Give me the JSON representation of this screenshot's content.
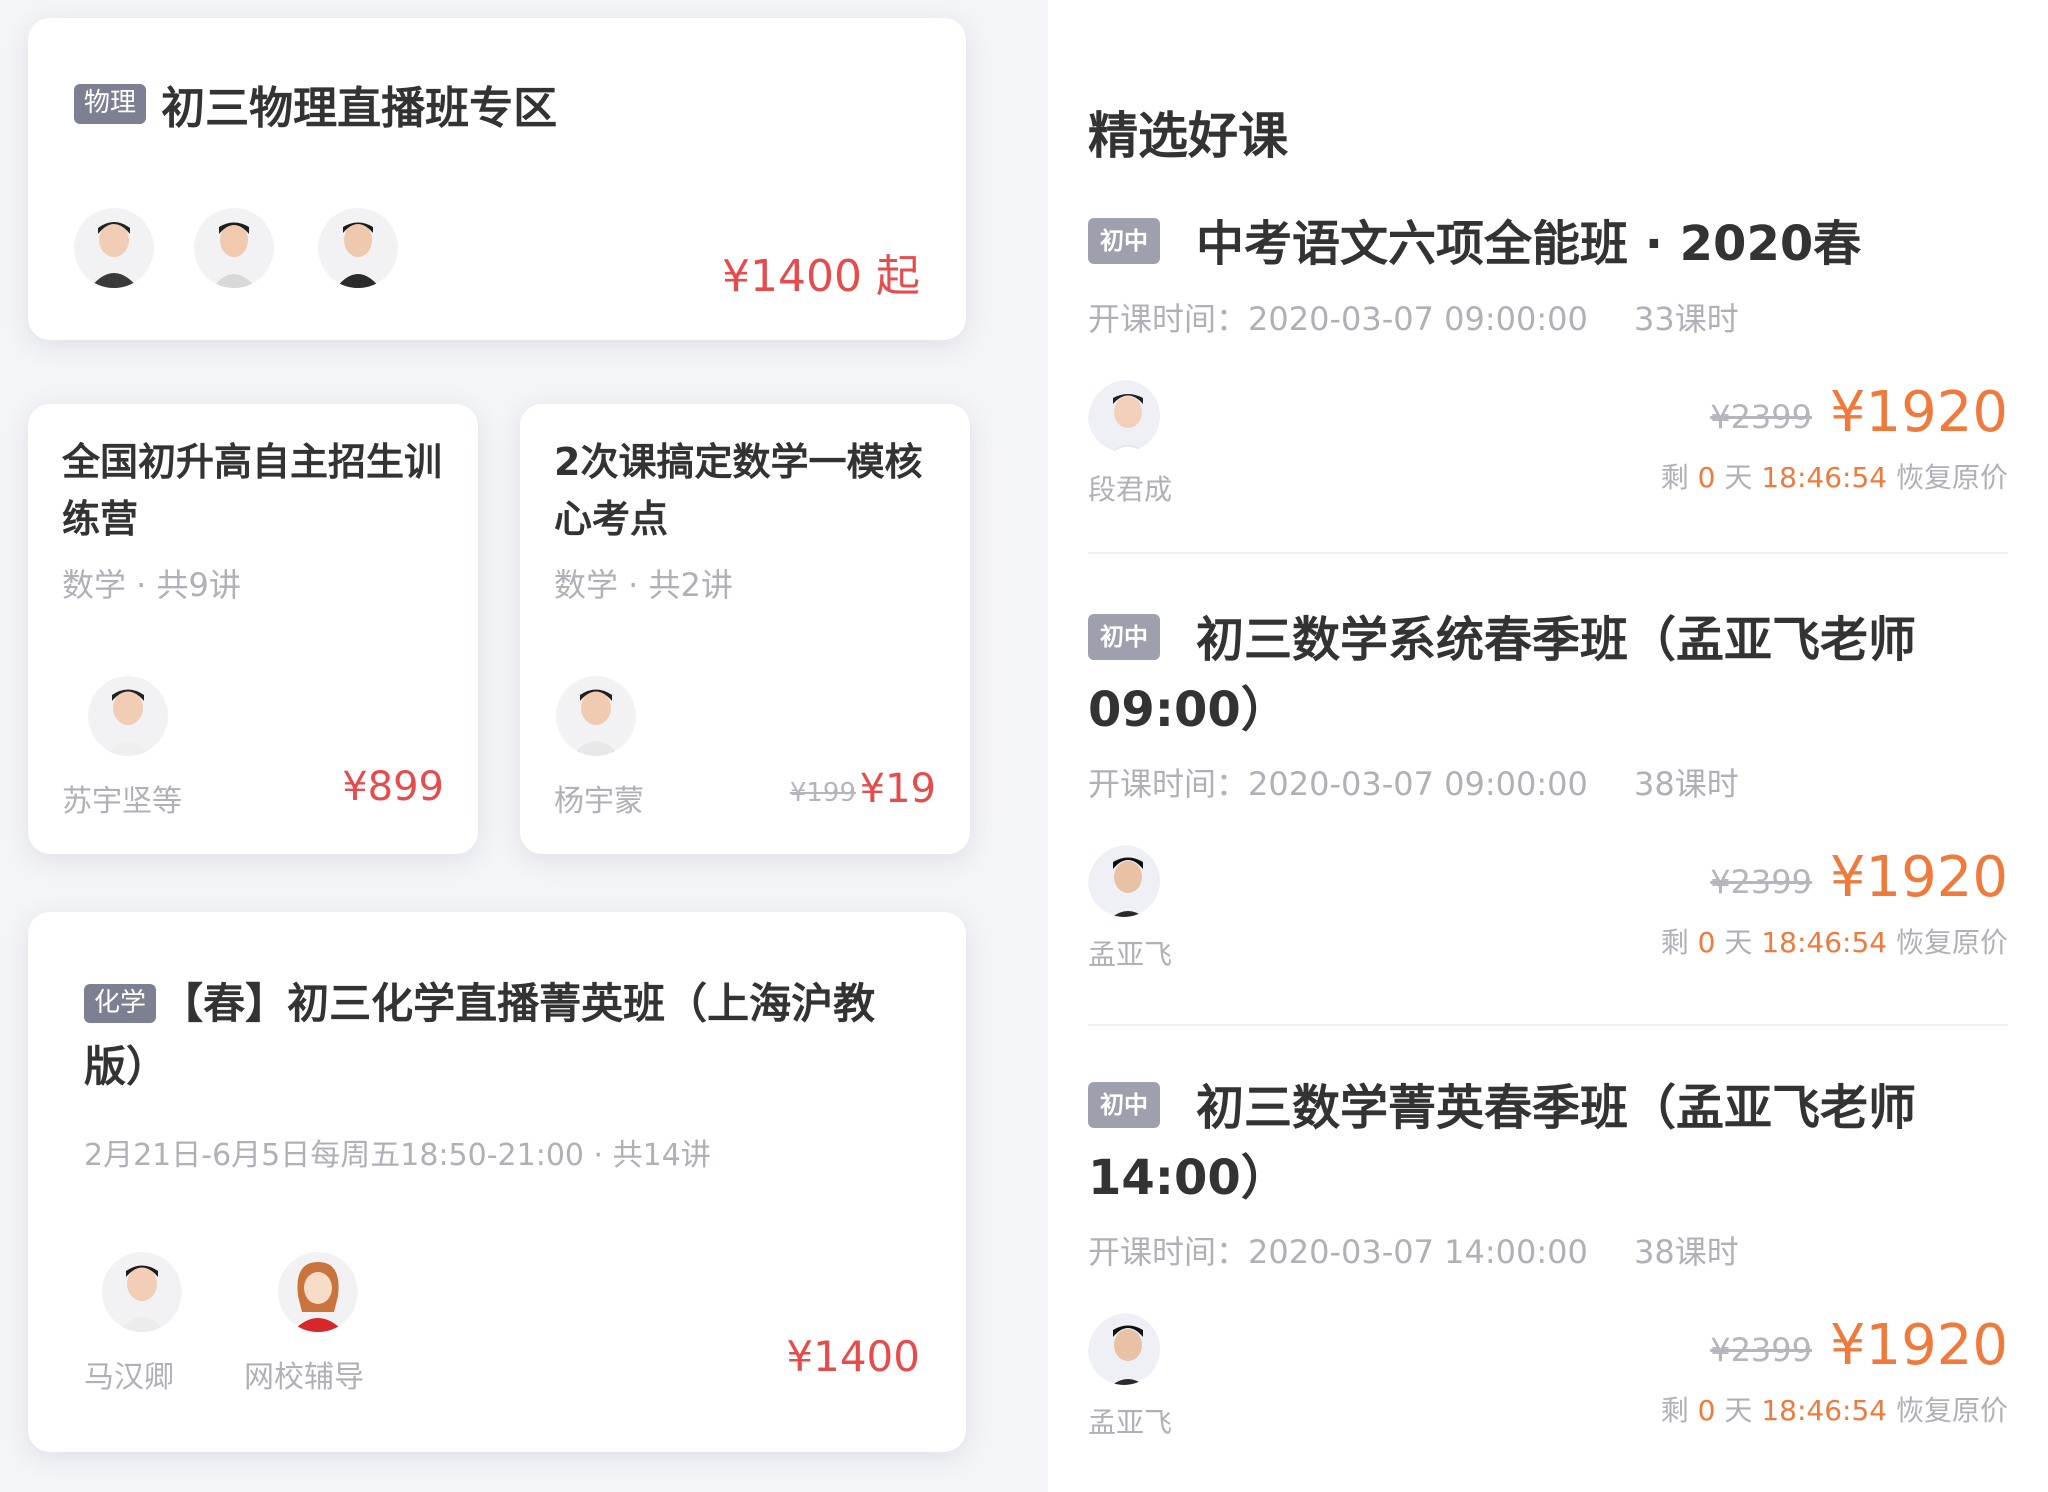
{
  "physics_card": {
    "tag": "物理",
    "title": "初三物理直播班专区",
    "price": "¥1400 起"
  },
  "card_a": {
    "title": "全国初升高自主招生训练营",
    "meta": "数学 · 共9讲",
    "teacher": "苏宇坚等",
    "price": "¥899"
  },
  "card_b": {
    "title": "2次课搞定数学一模核心考点",
    "meta": "数学 · 共2讲",
    "teacher": "杨宇蒙",
    "old_price": "¥199",
    "price": "¥19"
  },
  "chem_card": {
    "tag": "化学",
    "title": "【春】初三化学直播菁英班（上海沪教版）",
    "meta": "2月21日-6月5日每周五18:50-21:00 · 共14讲",
    "teacher1": "马汉卿",
    "teacher2": "网校辅导",
    "price": "¥1400"
  },
  "featured": {
    "section_title": "精选好课",
    "courses": [
      {
        "tag": "初中",
        "title": "中考语文六项全能班 · 2020春",
        "start_time": "开课时间：2020-03-07 09:00:00",
        "hours": "33课时",
        "teacher": "段君成",
        "old_price": "¥2399",
        "price": "¥1920",
        "countdown_prefix": "剩",
        "countdown_days": "0",
        "countdown_unit": "天",
        "countdown_time": "18:46:54",
        "countdown_suffix": "恢复原价"
      },
      {
        "tag": "初中",
        "title": "初三数学系统春季班（孟亚飞老师09:00）",
        "start_time": "开课时间：2020-03-07 09:00:00",
        "hours": "38课时",
        "teacher": "孟亚飞",
        "old_price": "¥2399",
        "price": "¥1920",
        "countdown_prefix": "剩",
        "countdown_days": "0",
        "countdown_unit": "天",
        "countdown_time": "18:46:54",
        "countdown_suffix": "恢复原价"
      },
      {
        "tag": "初中",
        "title": "初三数学菁英春季班（孟亚飞老师14:00）",
        "start_time": "开课时间：2020-03-07 14:00:00",
        "hours": "38课时",
        "teacher": "孟亚飞",
        "old_price": "¥2399",
        "price": "¥1920",
        "countdown_prefix": "剩",
        "countdown_days": "0",
        "countdown_unit": "天",
        "countdown_time": "18:46:54",
        "countdown_suffix": "恢复原价"
      }
    ]
  },
  "colors": {
    "price_red": "#e74c4c",
    "price_orange": "#f07a3c",
    "tag_gray": "#7d8093"
  }
}
